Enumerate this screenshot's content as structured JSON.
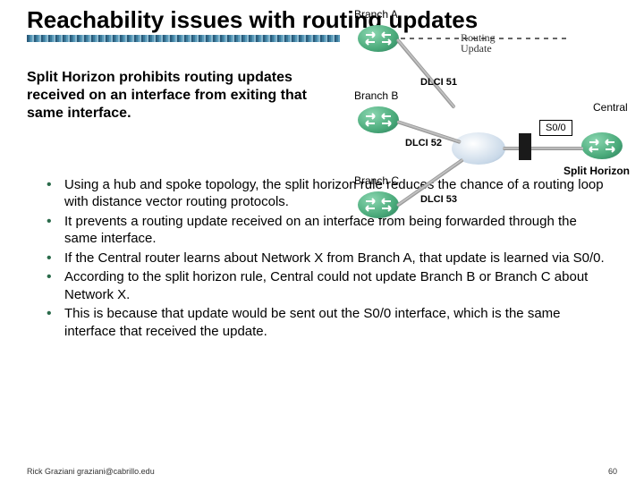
{
  "title": "Reachability issues with routing updates",
  "subtitle": "Split Horizon prohibits routing updates received on an interface from exiting that same interface.",
  "bullets": [
    "Using a hub and spoke topology, the split horizon rule reduces the chance of a routing loop with distance vector routing protocols.",
    "It prevents a routing update received on an interface from being forwarded through the same interface.",
    "If the Central router learns about Network X from Branch A, that update is learned via S0/0.",
    "According to the split horizon rule, Central could not update Branch B or Branch C about Network X.",
    "This is because that update would be sent out the S0/0 interface, which is the same interface that received the update."
  ],
  "diagram": {
    "branch_a": "Branch A",
    "branch_b": "Branch B",
    "branch_c": "Branch C",
    "central": "Central",
    "dlci51": "DLCI 51",
    "dlci52": "DLCI 52",
    "dlci53": "DLCI 53",
    "s00": "S0/0",
    "split_horizon": "Split Horizon",
    "routing_update": "Routing Update"
  },
  "footer": {
    "left": "Rick Graziani  graziani@cabrillo.edu",
    "right": "60"
  }
}
